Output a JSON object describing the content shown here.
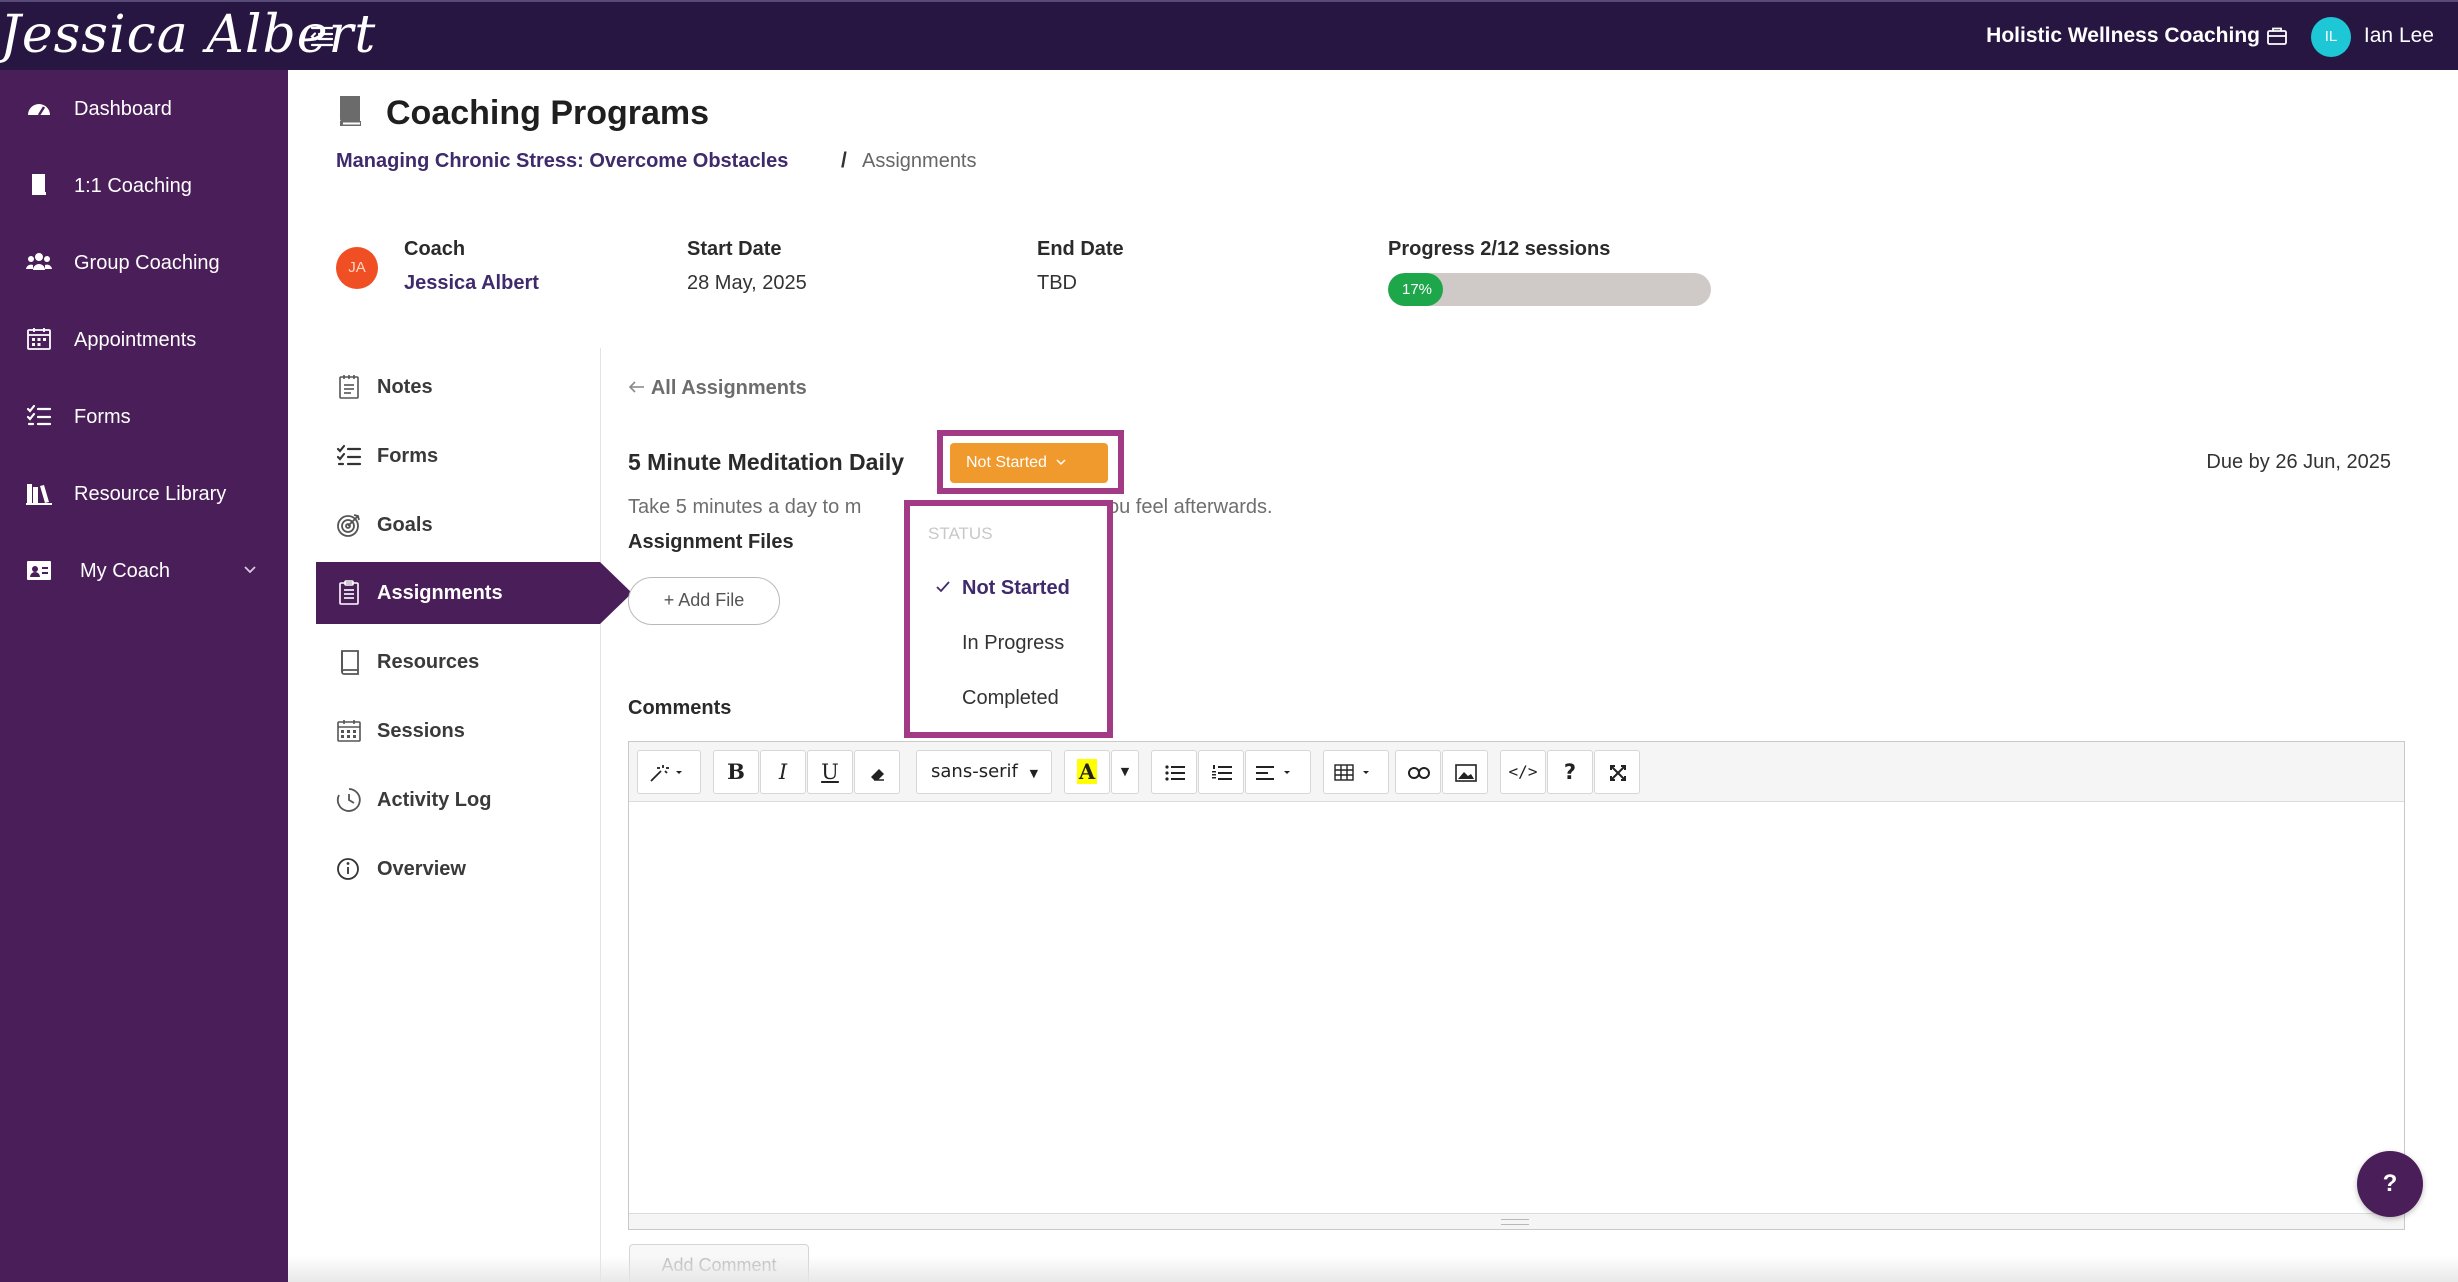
{
  "topbar": {
    "logo_text": "Jessica Albert",
    "company": "Holistic Wellness Coaching",
    "user_initials": "IL",
    "user_name": "Ian Lee"
  },
  "sidebar": {
    "items": [
      {
        "label": "Dashboard",
        "icon": "dashboard-gauge-icon"
      },
      {
        "label": "1:1 Coaching",
        "icon": "book-icon"
      },
      {
        "label": "Group Coaching",
        "icon": "users-icon"
      },
      {
        "label": "Appointments",
        "icon": "calendar-icon"
      },
      {
        "label": "Forms",
        "icon": "checklist-icon"
      },
      {
        "label": "Resource Library",
        "icon": "library-icon"
      },
      {
        "label": "My Coach",
        "icon": "coach-card-icon"
      }
    ]
  },
  "header": {
    "title": "Coaching Programs",
    "breadcrumb_program": "Managing Chronic Stress: Overcome Obstacles",
    "breadcrumb_separator": "/",
    "breadcrumb_current": "Assignments"
  },
  "program_info": {
    "coach_label": "Coach",
    "coach_initials": "JA",
    "coach_name": "Jessica Albert",
    "start_label": "Start Date",
    "start_value": "28 May, 2025",
    "end_label": "End Date",
    "end_value": "TBD",
    "progress_label": "Progress 2/12 sessions",
    "progress_text": "17%",
    "progress_fraction": 0.17
  },
  "subnav": {
    "items": [
      {
        "label": "Notes",
        "icon": "notepad-icon"
      },
      {
        "label": "Forms",
        "icon": "checklist-icon"
      },
      {
        "label": "Goals",
        "icon": "target-icon"
      },
      {
        "label": "Assignments",
        "icon": "clipboard-icon",
        "active": true
      },
      {
        "label": "Resources",
        "icon": "book-outline-icon"
      },
      {
        "label": "Sessions",
        "icon": "calendar-grid-icon"
      },
      {
        "label": "Activity Log",
        "icon": "clock-history-icon"
      },
      {
        "label": "Overview",
        "icon": "info-circle-icon"
      }
    ]
  },
  "assignment": {
    "back_label": "All Assignments",
    "title": "5 Minute Meditation Daily",
    "status": "Not Started",
    "due": "Due by 26 Jun, 2025",
    "description_left": "Take 5 minutes a day to m",
    "description_right": "ou feel afterwards.",
    "files_label": "Assignment Files",
    "add_file_label": "Add File",
    "comments_label": "Comments",
    "add_comment_label": "Add Comment"
  },
  "status_dropdown": {
    "header": "STATUS",
    "options": [
      {
        "label": "Not Started",
        "selected": true
      },
      {
        "label": "In Progress",
        "selected": false
      },
      {
        "label": "Completed",
        "selected": false
      }
    ]
  },
  "editor_toolbar": {
    "font_name": "sans-serif",
    "bold": "B",
    "italic": "I",
    "underline": "U",
    "highlight": "A",
    "code": "</>",
    "help": "?"
  },
  "help_button": "?",
  "colors": {
    "topbar": "#271642",
    "sidebar": "#4a1e58",
    "status_orange": "#f0992c",
    "highlight_frame": "#a23a86",
    "progress_green": "#1ea64b",
    "coach_avatar": "#f04e23",
    "user_avatar": "#1ec7d6"
  }
}
